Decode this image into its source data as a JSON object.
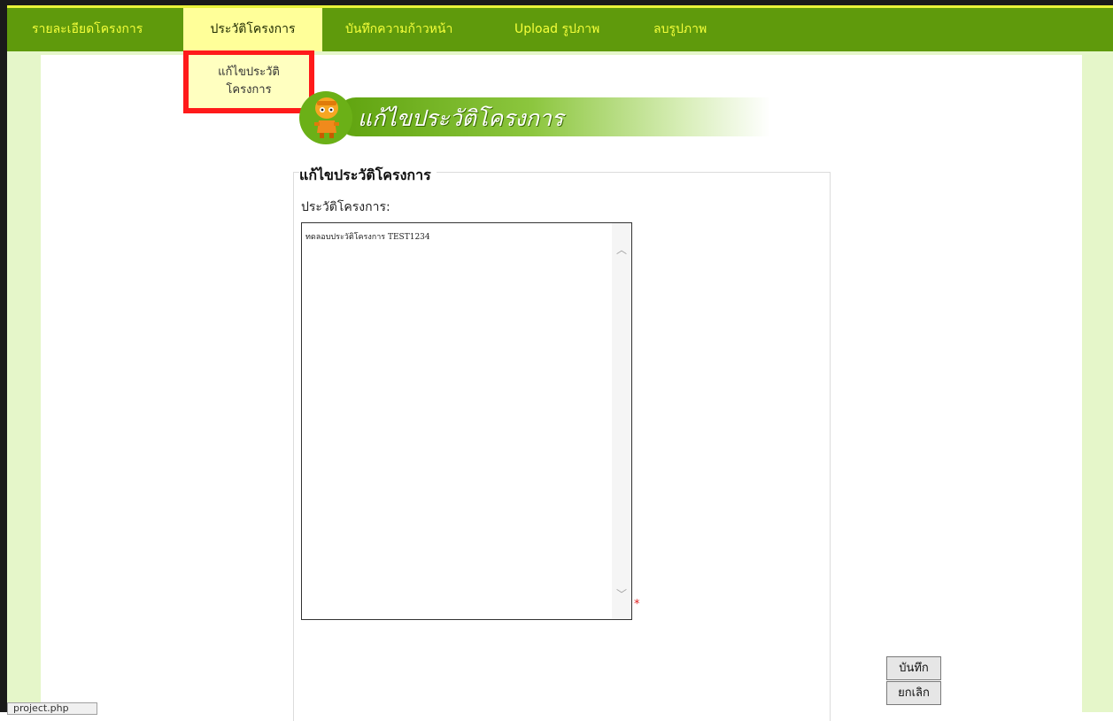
{
  "nav": {
    "items": [
      {
        "label": "รายละเอียดโครงการ"
      },
      {
        "label": "ประวัติโครงการ",
        "active": true
      },
      {
        "label": "บันทึกความก้าวหน้า"
      },
      {
        "label": "Upload รูปภาพ"
      },
      {
        "label": "ลบรูปภาพ"
      }
    ],
    "dropdown": {
      "line1": "แก้ไขประวัติ",
      "line2": "โครงการ"
    }
  },
  "banner": {
    "title": "แก้ไขประวัติโครงการ",
    "icon": "mascot-icon"
  },
  "form": {
    "legend": "แก้ไขประวัติโครงการ",
    "history_label": "ประวัติโครงการ:",
    "history_value": "ทดลอบประวัติโครงการ TEST1234",
    "required_mark": "*"
  },
  "buttons": {
    "save": "บันทึก",
    "cancel": "ยกเลิก"
  },
  "status": {
    "text": "project.php"
  },
  "colors": {
    "nav_bg": "#5f9a0c",
    "nav_text": "#f5ff3a",
    "active_tab_bg": "#ffff99",
    "side_bg": "#e5f6c9",
    "highlight_border": "#ff1a1a"
  }
}
